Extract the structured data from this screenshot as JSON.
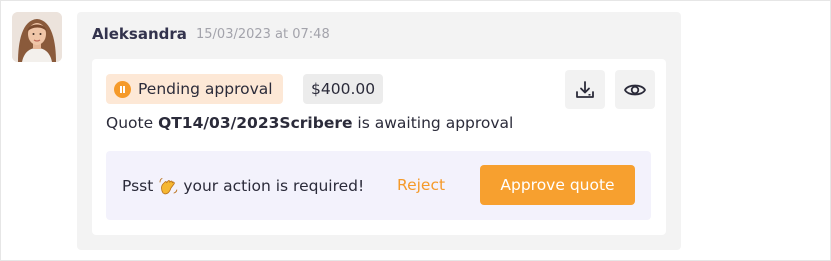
{
  "message": {
    "author": "Aleksandra",
    "timestamp": "15/03/2023 at 07:48",
    "avatar_icon": "user-photo"
  },
  "quote": {
    "status": "Pending approval",
    "status_icon": "pause-circle-icon",
    "amount": "$400.00",
    "text_prefix": "Quote ",
    "reference": "QT14/03/2023Scribere",
    "text_suffix": " is awaiting approval"
  },
  "toolbar": {
    "download_icon": "download-icon",
    "view_icon": "eye-icon"
  },
  "action": {
    "prompt_before": "Psst",
    "prompt_emoji": "waving-hand-icon",
    "prompt_after": "your action is required!",
    "reject_label": "Reject",
    "approve_label": "Approve quote"
  },
  "colors": {
    "accent": "#f7a02f",
    "status_bg": "#fde8d6",
    "action_bg": "#f3f2fc",
    "bubble_bg": "#f3f3f3"
  }
}
